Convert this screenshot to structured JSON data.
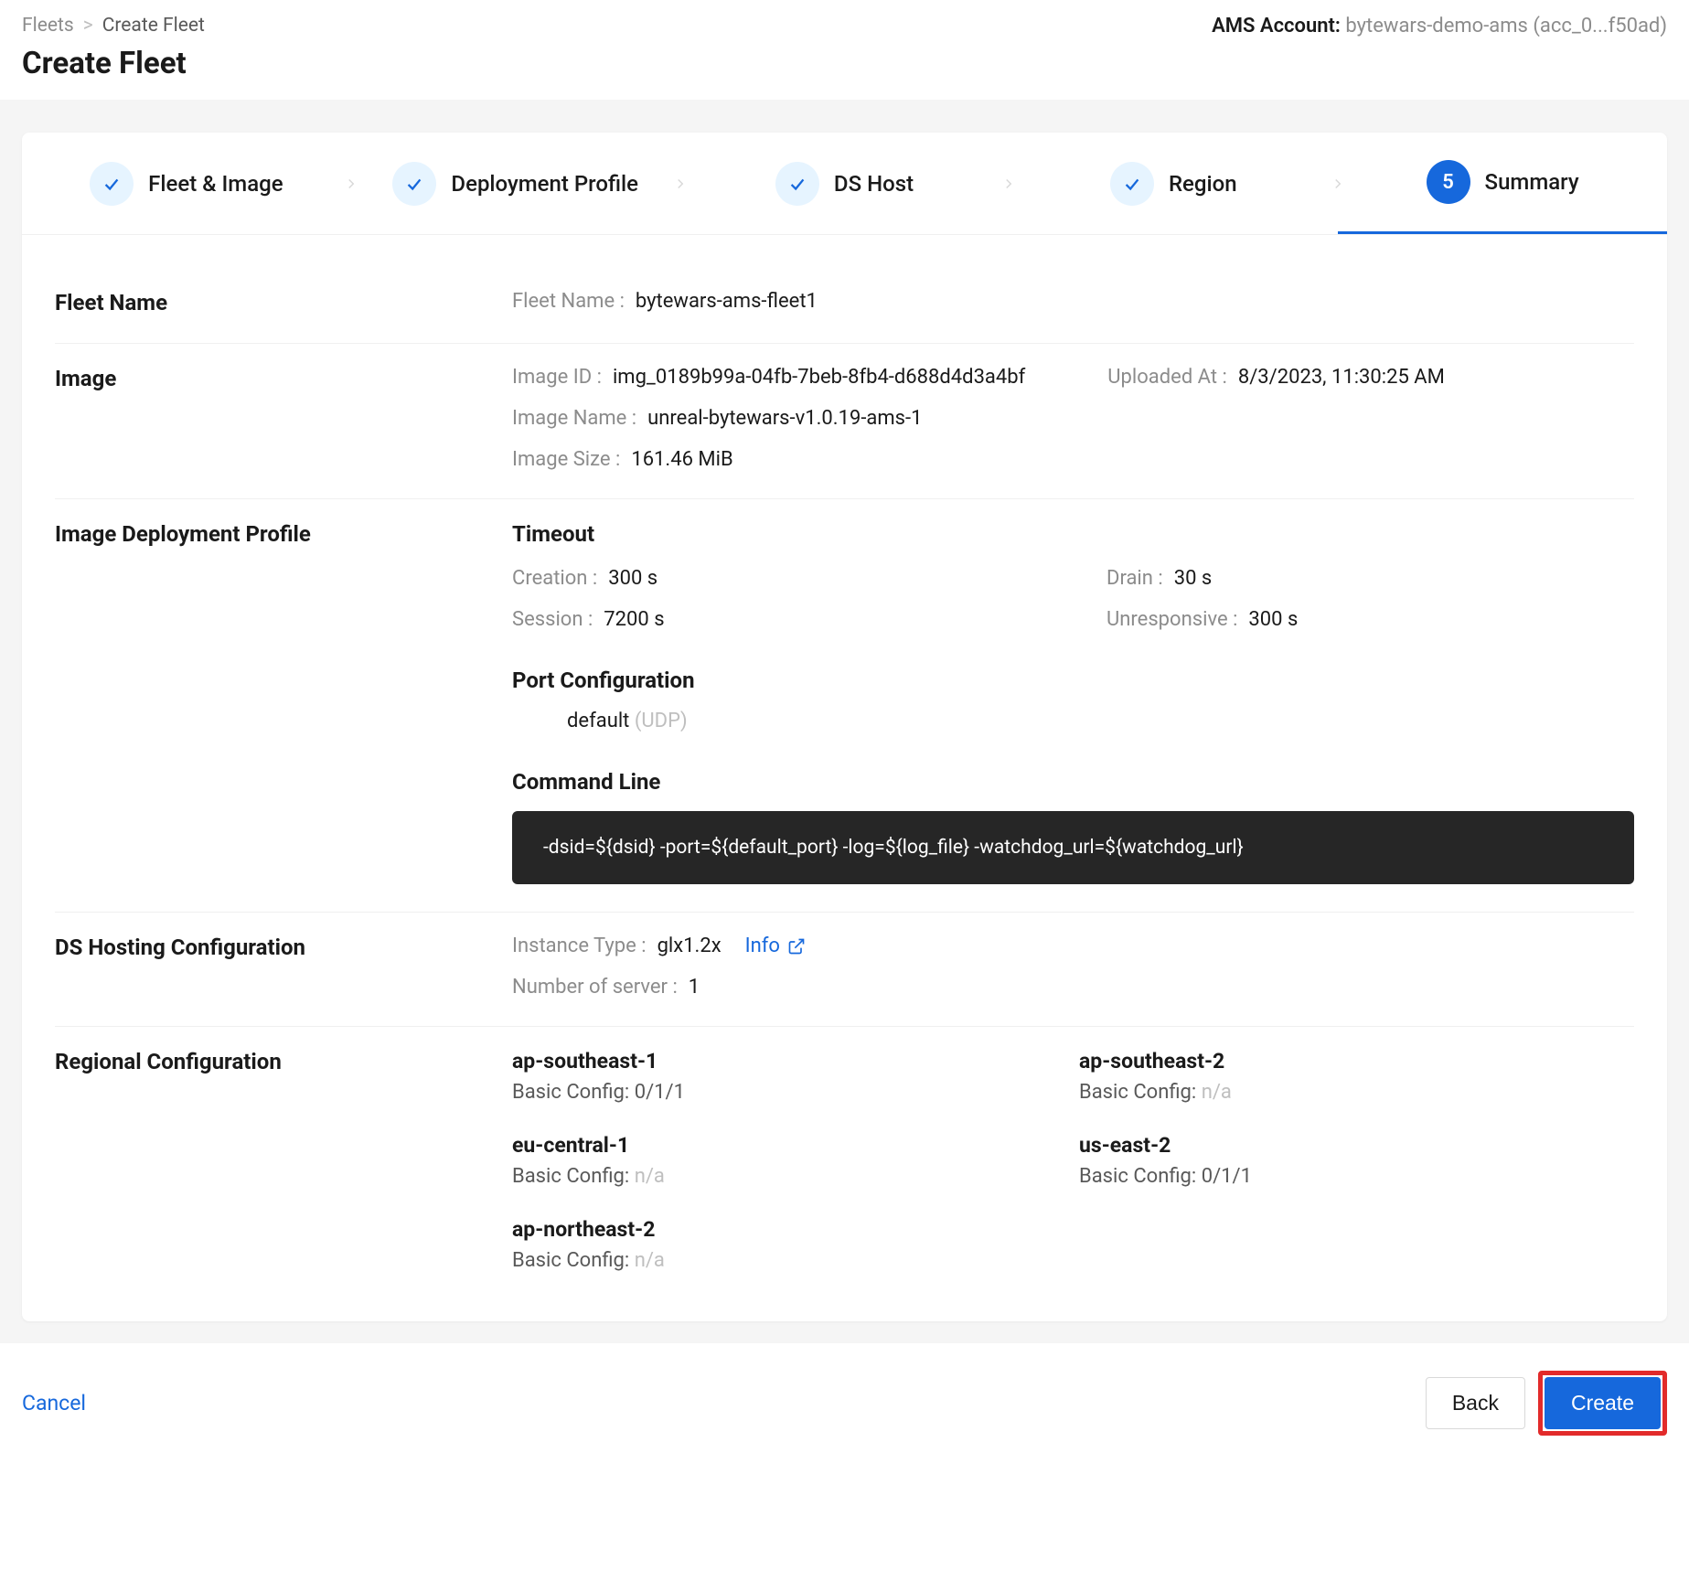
{
  "breadcrumb": {
    "root": "Fleets",
    "sep": ">",
    "current": "Create Fleet"
  },
  "page_title": "Create Fleet",
  "account": {
    "label": "AMS Account: ",
    "value": "bytewars-demo-ams (acc_0...f50ad)"
  },
  "stepper": {
    "s1": "Fleet & Image",
    "s2": "Deployment Profile",
    "s3": "DS Host",
    "s4": "Region",
    "s5_num": "5",
    "s5": "Summary"
  },
  "fleet_name": {
    "title": "Fleet Name",
    "key": "Fleet Name :",
    "val": "bytewars-ams-fleet1"
  },
  "image": {
    "title": "Image",
    "id_key": "Image ID :",
    "id_val": "img_0189b99a-04fb-7beb-8fb4-d688d4d3a4bf",
    "uploaded_key": "Uploaded At :",
    "uploaded_val": "8/3/2023, 11:30:25 AM",
    "name_key": "Image Name :",
    "name_val": "unreal-bytewars-v1.0.19-ams-1",
    "size_key": "Image Size :",
    "size_val": "161.46 MiB"
  },
  "profile": {
    "title": "Image Deployment Profile",
    "timeout_heading": "Timeout",
    "creation_key": "Creation :",
    "creation_val": "300 s",
    "drain_key": "Drain :",
    "drain_val": "30 s",
    "session_key": "Session :",
    "session_val": "7200 s",
    "unresp_key": "Unresponsive :",
    "unresp_val": "300 s",
    "port_heading": "Port Configuration",
    "port_name": "default",
    "port_proto": "(UDP)",
    "cmd_heading": "Command Line",
    "cmd_val": "-dsid=${dsid} -port=${default_port} -log=${log_file} -watchdog_url=${watchdog_url}"
  },
  "dshost": {
    "title": "DS Hosting Configuration",
    "instance_key": "Instance Type :",
    "instance_val": "glx1.2x",
    "info_label": "Info",
    "servers_key": "Number of server :",
    "servers_val": "1"
  },
  "regions": {
    "title": "Regional Configuration",
    "config_label": "Basic Config: ",
    "items": [
      {
        "name": "ap-southeast-1",
        "config": "0/1/1",
        "na": false
      },
      {
        "name": "ap-southeast-2",
        "config": "n/a",
        "na": true
      },
      {
        "name": "eu-central-1",
        "config": "n/a",
        "na": true
      },
      {
        "name": "us-east-2",
        "config": "0/1/1",
        "na": false
      },
      {
        "name": "ap-northeast-2",
        "config": "n/a",
        "na": true
      }
    ]
  },
  "footer": {
    "cancel": "Cancel",
    "back": "Back",
    "create": "Create"
  }
}
